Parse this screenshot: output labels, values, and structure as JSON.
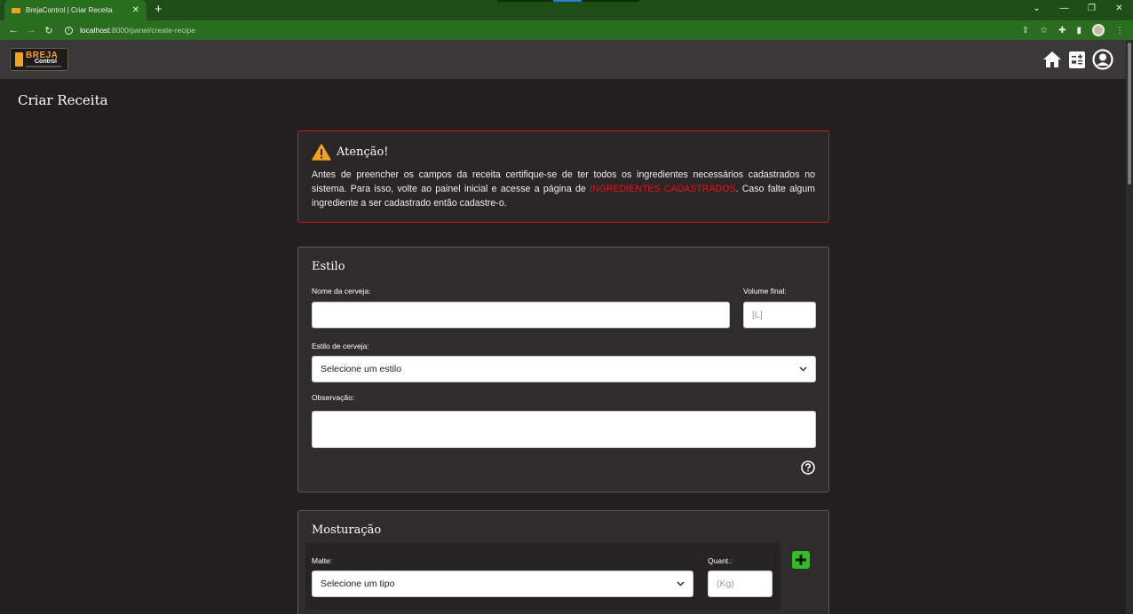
{
  "browser": {
    "tab_title": "BrejaControl | Criar Receita",
    "tab_close": "✕",
    "new_tab": "+",
    "url_host": "localhost",
    "url_rest": ":8000/panel/create-recipe",
    "win_controls": [
      "⌄",
      "—",
      "❐",
      "✕"
    ]
  },
  "app": {
    "logo_text_1": "BREJA",
    "logo_text_2": "Control",
    "page_title": "Criar Receita"
  },
  "warning": {
    "title": "Atenção!",
    "text_before": "Antes de preencher os campos da receita certifique-se de ter todos os ingredientes necessários cadastrados no sistema. Para isso, volte ao painel inicial e acesse a página de ",
    "link": "INGREDIENTES CADASTRADOS",
    "text_after": ". Caso falte algum ingrediente a ser cadastrado então cadastre-o."
  },
  "estilo": {
    "title": "Estilo",
    "beer_name_label": "Nome da cerveja:",
    "beer_name_value": "",
    "volume_label": "Volume final:",
    "volume_placeholder": "[L]",
    "style_label": "Estilo de cerveja:",
    "style_selected": "Selecione um estilo",
    "obs_label": "Observação:",
    "obs_value": ""
  },
  "mosturacao": {
    "title": "Mosturação",
    "malt_label": "Malte:",
    "malt_selected": "Selecione um tipo",
    "qty_label": "Quant.:",
    "qty_placeholder": "(Kg)"
  },
  "colors": {
    "accent_red": "#d11b1b",
    "add_green": "#2fbf25",
    "brand_orange": "#f3a21b"
  }
}
